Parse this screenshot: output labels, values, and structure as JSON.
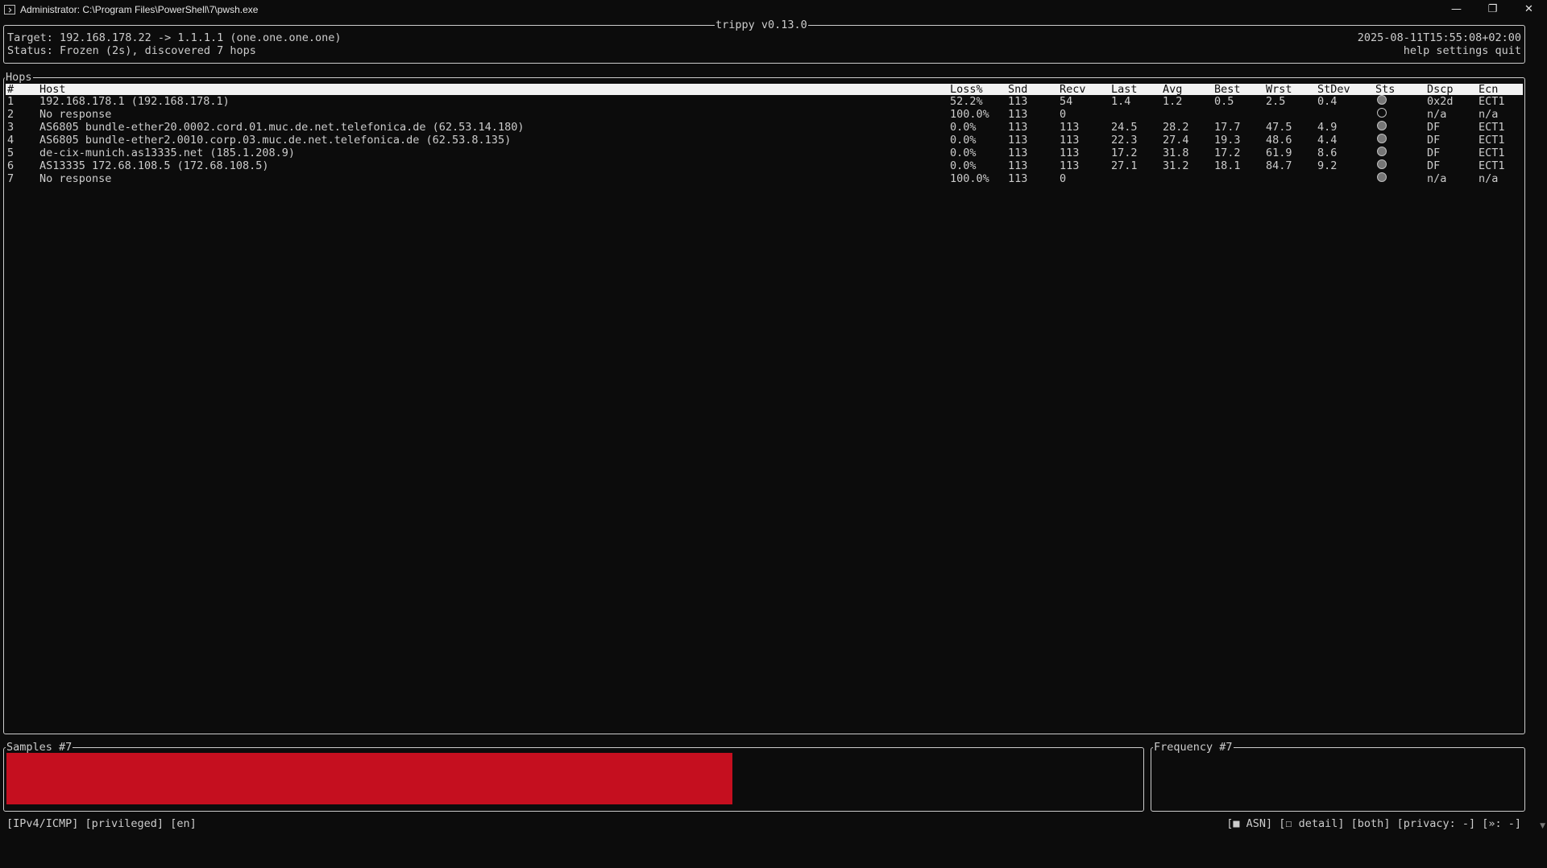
{
  "window": {
    "title": "Administrator: C:\\Program Files\\PowerShell\\7\\pwsh.exe",
    "minimize": "—",
    "restore": "❐",
    "close": "✕"
  },
  "header": {
    "app_title": "trippy v0.13.0",
    "target": "Target: 192.168.178.22 -> 1.1.1.1 (one.one.one.one)",
    "status": "Status: Frozen (2s), discovered 7 hops",
    "datetime": "2025-08-11T15:55:08+02:00",
    "menu": "help settings quit"
  },
  "hops": {
    "title": "Hops",
    "columns": [
      "#",
      "Host",
      "Loss%",
      "Snd",
      "Recv",
      "Last",
      "Avg",
      "Best",
      "Wrst",
      "StDev",
      "Sts",
      "Dscp",
      "Ecn"
    ],
    "rows": [
      {
        "n": "1",
        "host": "192.168.178.1 (192.168.178.1)",
        "loss": "52.2%",
        "snd": "113",
        "recv": "54",
        "last": "1.4",
        "avg": "1.2",
        "best": "0.5",
        "wrst": "2.5",
        "stdev": "0.4",
        "sts": "filled",
        "dscp": "0x2d",
        "ecn": "ECT1"
      },
      {
        "n": "2",
        "host": "No response",
        "loss": "100.0%",
        "snd": "113",
        "recv": "0",
        "last": "",
        "avg": "",
        "best": "",
        "wrst": "",
        "stdev": "",
        "sts": "empty",
        "dscp": "n/a",
        "ecn": "n/a"
      },
      {
        "n": "3",
        "host": "AS6805 bundle-ether20.0002.cord.01.muc.de.net.telefonica.de (62.53.14.180)",
        "loss": "0.0%",
        "snd": "113",
        "recv": "113",
        "last": "24.5",
        "avg": "28.2",
        "best": "17.7",
        "wrst": "47.5",
        "stdev": "4.9",
        "sts": "filled",
        "dscp": "DF",
        "ecn": "ECT1"
      },
      {
        "n": "4",
        "host": "AS6805 bundle-ether2.0010.corp.03.muc.de.net.telefonica.de (62.53.8.135)",
        "loss": "0.0%",
        "snd": "113",
        "recv": "113",
        "last": "22.3",
        "avg": "27.4",
        "best": "19.3",
        "wrst": "48.6",
        "stdev": "4.4",
        "sts": "filled",
        "dscp": "DF",
        "ecn": "ECT1"
      },
      {
        "n": "5",
        "host": "de-cix-munich.as13335.net (185.1.208.9)",
        "loss": "0.0%",
        "snd": "113",
        "recv": "113",
        "last": "17.2",
        "avg": "31.8",
        "best": "17.2",
        "wrst": "61.9",
        "stdev": "8.6",
        "sts": "filled",
        "dscp": "DF",
        "ecn": "ECT1"
      },
      {
        "n": "6",
        "host": "AS13335 172.68.108.5 (172.68.108.5)",
        "loss": "0.0%",
        "snd": "113",
        "recv": "113",
        "last": "27.1",
        "avg": "31.2",
        "best": "18.1",
        "wrst": "84.7",
        "stdev": "9.2",
        "sts": "filled",
        "dscp": "DF",
        "ecn": "ECT1"
      },
      {
        "n": "7",
        "host": "No response",
        "loss": "100.0%",
        "snd": "113",
        "recv": "0",
        "last": "",
        "avg": "",
        "best": "",
        "wrst": "",
        "stdev": "",
        "sts": "filled",
        "dscp": "n/a",
        "ecn": "n/a"
      }
    ]
  },
  "samples": {
    "title": "Samples #7",
    "fill_fraction": 0.64,
    "bar_color": "#c50f1f"
  },
  "frequency": {
    "title": "Frequency #7"
  },
  "statusbar": {
    "left": "[IPv4/ICMP] [privileged] [en]",
    "right": "[■ ASN] [☐ detail] [both] [privacy: -] [»: -]"
  },
  "colors": {
    "background": "#0c0c0c",
    "foreground": "#cccccc",
    "header_bg": "#f2f2f2",
    "accent_red": "#c50f1f"
  }
}
